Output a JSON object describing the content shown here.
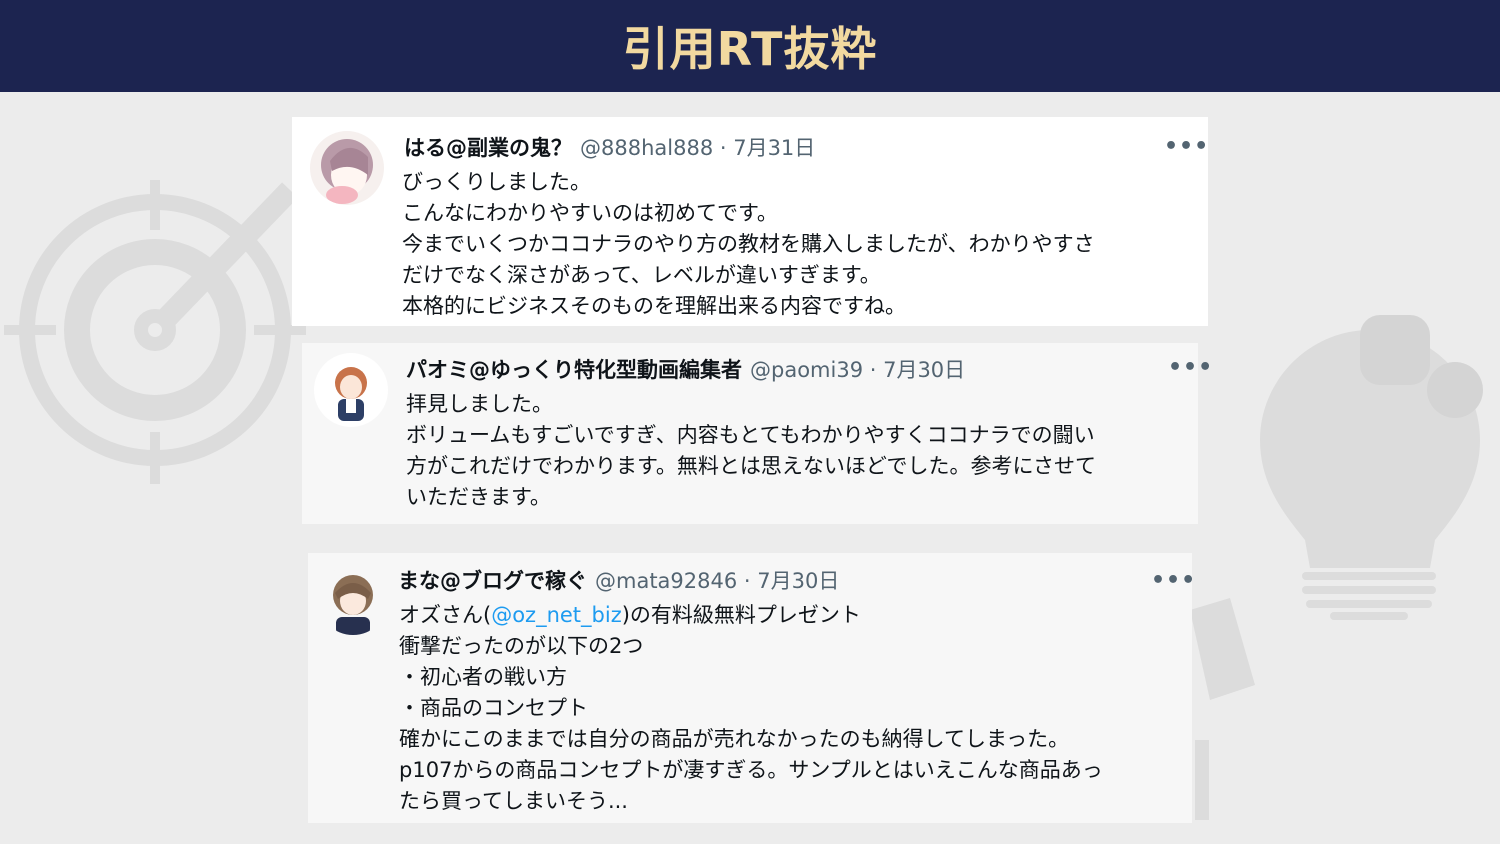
{
  "page": {
    "title": "引用RT抜粋"
  },
  "colors": {
    "header_bg": "#1c2450",
    "title": "#f2d9a0",
    "mention": "#1d9bf0"
  },
  "tweets": [
    {
      "name": "はる@副業の鬼？",
      "handle": "@888hal888 · 7月31日",
      "more_icon": "more-icon",
      "lines": [
        "びっくりしました。",
        "こんなにわかりやすいのは初めてです。",
        "今までいくつかココナラのやり方の教材を購入しましたが、わかりやすさ",
        "だけでなく深さがあって、レベルが違いすぎます。",
        "本格的にビジネスそのものを理解出来る内容ですね。"
      ]
    },
    {
      "name": "パオミ@ゆっくり特化型動画編集者",
      "handle": "@paomi39 · 7月30日",
      "more_icon": "more-icon",
      "lines": [
        "拝見しました。",
        "ボリュームもすごいですぎ、内容もとてもわかりやすくココナラでの闘い",
        "方がこれだけでわかります。無料とは思えないほどでした。参考にさせて",
        "いただきます。"
      ]
    },
    {
      "name": "まな@ブログで稼ぐ",
      "handle": "@mata92846 · 7月30日",
      "more_icon": "more-icon",
      "line1_prefix": "オズさん(",
      "mention": "@oz_net_biz",
      "line1_suffix": ")の有料級無料プレゼント",
      "lines": [
        "衝撃だったのが以下の2つ",
        "・初心者の戦い方",
        "・商品のコンセプト",
        "確かにこのままでは自分の商品が売れなかったのも納得してしまった。",
        "p107からの商品コンセプトが凄すぎる。サンプルとはいえこんな商品あっ",
        "たら買ってしまいそう..."
      ]
    }
  ]
}
